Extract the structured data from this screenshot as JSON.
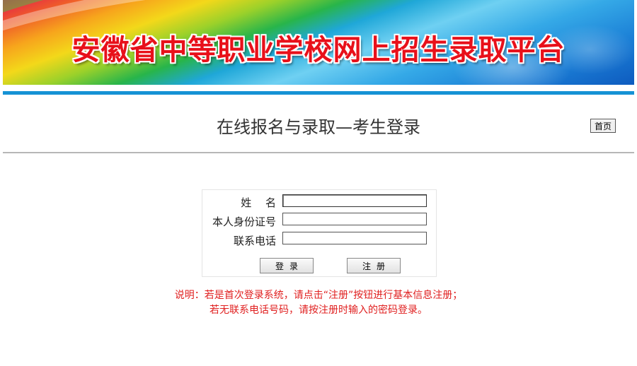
{
  "banner": {
    "title": "安徽省中等职业学校网上招生录取平台"
  },
  "header": {
    "page_title": "在线报名与录取—考生登录",
    "home_label": "首页"
  },
  "login": {
    "name_label": "姓　 名",
    "name_value": "",
    "id_label": "本人身份证号",
    "id_value": "",
    "phone_label": "联系电话",
    "phone_value": "",
    "login_label": "登录",
    "register_label": "注册"
  },
  "notice": {
    "line1": "说明：若是首次登录系统，请点击“注册”按钮进行基本信息注册；",
    "line2": "若无联系电话号码，请按注册时输入的密码登录。"
  },
  "colors": {
    "title_red": "#e8101a",
    "accent_blue": "#1692d5",
    "notice_red": "#e02020"
  }
}
